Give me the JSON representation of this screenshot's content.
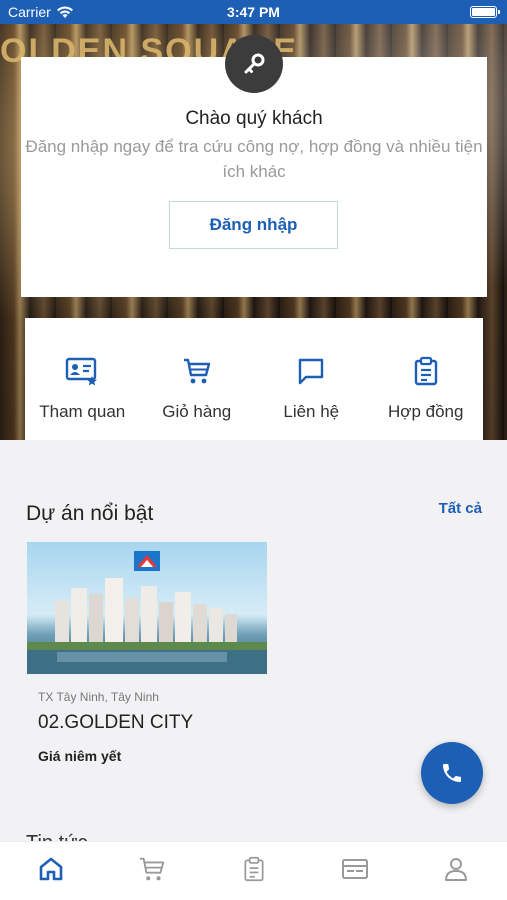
{
  "status_bar": {
    "carrier": "Carrier",
    "time": "3:47 PM"
  },
  "hero": {
    "sign_text": "OLDEN SQUARE"
  },
  "login": {
    "greeting": "Chào quý khách",
    "subtitle": "Đăng nhập ngay để tra cứu công nợ, hợp đồng và nhiều tiện ích khác",
    "button_label": "Đăng nhập"
  },
  "quick_actions": [
    {
      "label": "Tham quan",
      "icon": "id-card-icon"
    },
    {
      "label": "Giỏ hàng",
      "icon": "cart-icon"
    },
    {
      "label": "Liên hệ",
      "icon": "chat-icon"
    },
    {
      "label": "Hợp đồng",
      "icon": "clipboard-icon"
    }
  ],
  "featured": {
    "title": "Dự án nổi bật",
    "see_all": "Tất cả",
    "projects": [
      {
        "location": "TX Tây Ninh, Tây Ninh",
        "name": "02.GOLDEN CITY",
        "price_label": "Giá niêm yết"
      }
    ]
  },
  "next_section": {
    "title": "Tin tức"
  },
  "tab_bar": {
    "items": [
      {
        "icon": "home-icon",
        "active": true
      },
      {
        "icon": "cart-icon",
        "active": false
      },
      {
        "icon": "clipboard-icon",
        "active": false
      },
      {
        "icon": "card-icon",
        "active": false
      },
      {
        "icon": "person-icon",
        "active": false
      }
    ]
  },
  "colors": {
    "primary": "#1c5fb5",
    "inactive_tab": "#9a9a9a",
    "badge": "#3c3c3c"
  }
}
